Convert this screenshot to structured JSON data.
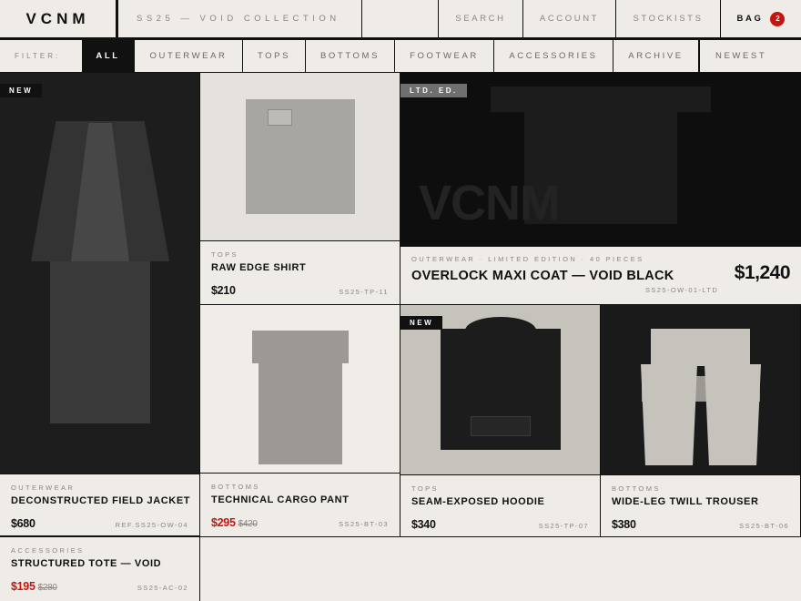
{
  "header": {
    "logo": "VCNM",
    "season": "SS25 — VOID COLLECTION",
    "nav": {
      "search": "SEARCH",
      "account": "ACCOUNT",
      "stockists": "STOCKISTS",
      "bag": "BAG"
    },
    "bag_count": "2"
  },
  "filters": {
    "label": "FILTER:",
    "chips": [
      "ALL",
      "OUTERWEAR",
      "TOPS",
      "BOTTOMS",
      "FOOTWEAR",
      "ACCESSORIES",
      "ARCHIVE"
    ],
    "active": "ALL",
    "sort": "NEWEST"
  },
  "products": {
    "jacket": {
      "badge": "NEW",
      "category": "OUTERWEAR",
      "name": "DECONSTRUCTED FIELD JACKET",
      "price": "$680",
      "ref": "REF.SS25-OW-04"
    },
    "shirt": {
      "category": "TOPS",
      "name": "RAW EDGE SHIRT",
      "price": "$210",
      "ref": "SS25-TP-11"
    },
    "coat": {
      "badge": "LTD. ED.",
      "watermark": "VCNM",
      "meta": "OUTERWEAR · LIMITED EDITION · 40 PIECES",
      "name": "OVERLOCK MAXI COAT — VOID BLACK",
      "price": "$1,240",
      "ref": "SS25-OW-01-LTD"
    },
    "cargo": {
      "category": "BOTTOMS",
      "name": "TECHNICAL CARGO PANT",
      "price": "$295",
      "old_price": "$420",
      "ref": "SS25-BT-03"
    },
    "hoodie": {
      "badge": "NEW",
      "category": "TOPS",
      "name": "SEAM-EXPOSED HOODIE",
      "price": "$340",
      "ref": "SS25-TP-07"
    },
    "trouser": {
      "category": "BOTTOMS",
      "name": "WIDE-LEG TWILL TROUSER",
      "price": "$380",
      "ref": "SS25-BT-06"
    },
    "tote": {
      "category": "ACCESSORIES",
      "name": "STRUCTURED TOTE — VOID",
      "price": "$195",
      "old_price": "$280",
      "ref": "SS25-AC-02"
    }
  },
  "colors": {
    "ink": "#111111",
    "paper": "#efebe7",
    "sale": "#c6150f",
    "ltd_badge": "#6f6f6f"
  }
}
